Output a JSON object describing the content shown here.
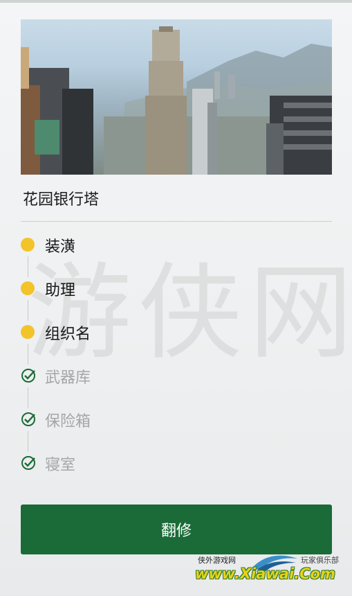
{
  "property": {
    "image_alt": "花园银行塔 skyline",
    "name": "花园银行塔"
  },
  "upgrades": [
    {
      "label": "装潢",
      "state": "pending"
    },
    {
      "label": "助理",
      "state": "pending"
    },
    {
      "label": "组织名",
      "state": "pending"
    },
    {
      "label": "武器库",
      "state": "done"
    },
    {
      "label": "保险箱",
      "state": "done"
    },
    {
      "label": "寝室",
      "state": "done"
    }
  ],
  "actions": {
    "renovate_label": "翻修"
  },
  "watermark": {
    "text": "游侠网"
  },
  "branding": {
    "site_name": "侠外游戏网",
    "club_name": "玩家俱乐部",
    "logo_text": "www.Xiawai.Com"
  },
  "colors": {
    "accent_green": "#1a6b37",
    "pending_dot": "#f2c42a",
    "done_check": "#1a6b37",
    "done_text": "#a6a6a6"
  },
  "icons": {
    "pending": "dot-icon",
    "done": "check-circle-icon"
  }
}
